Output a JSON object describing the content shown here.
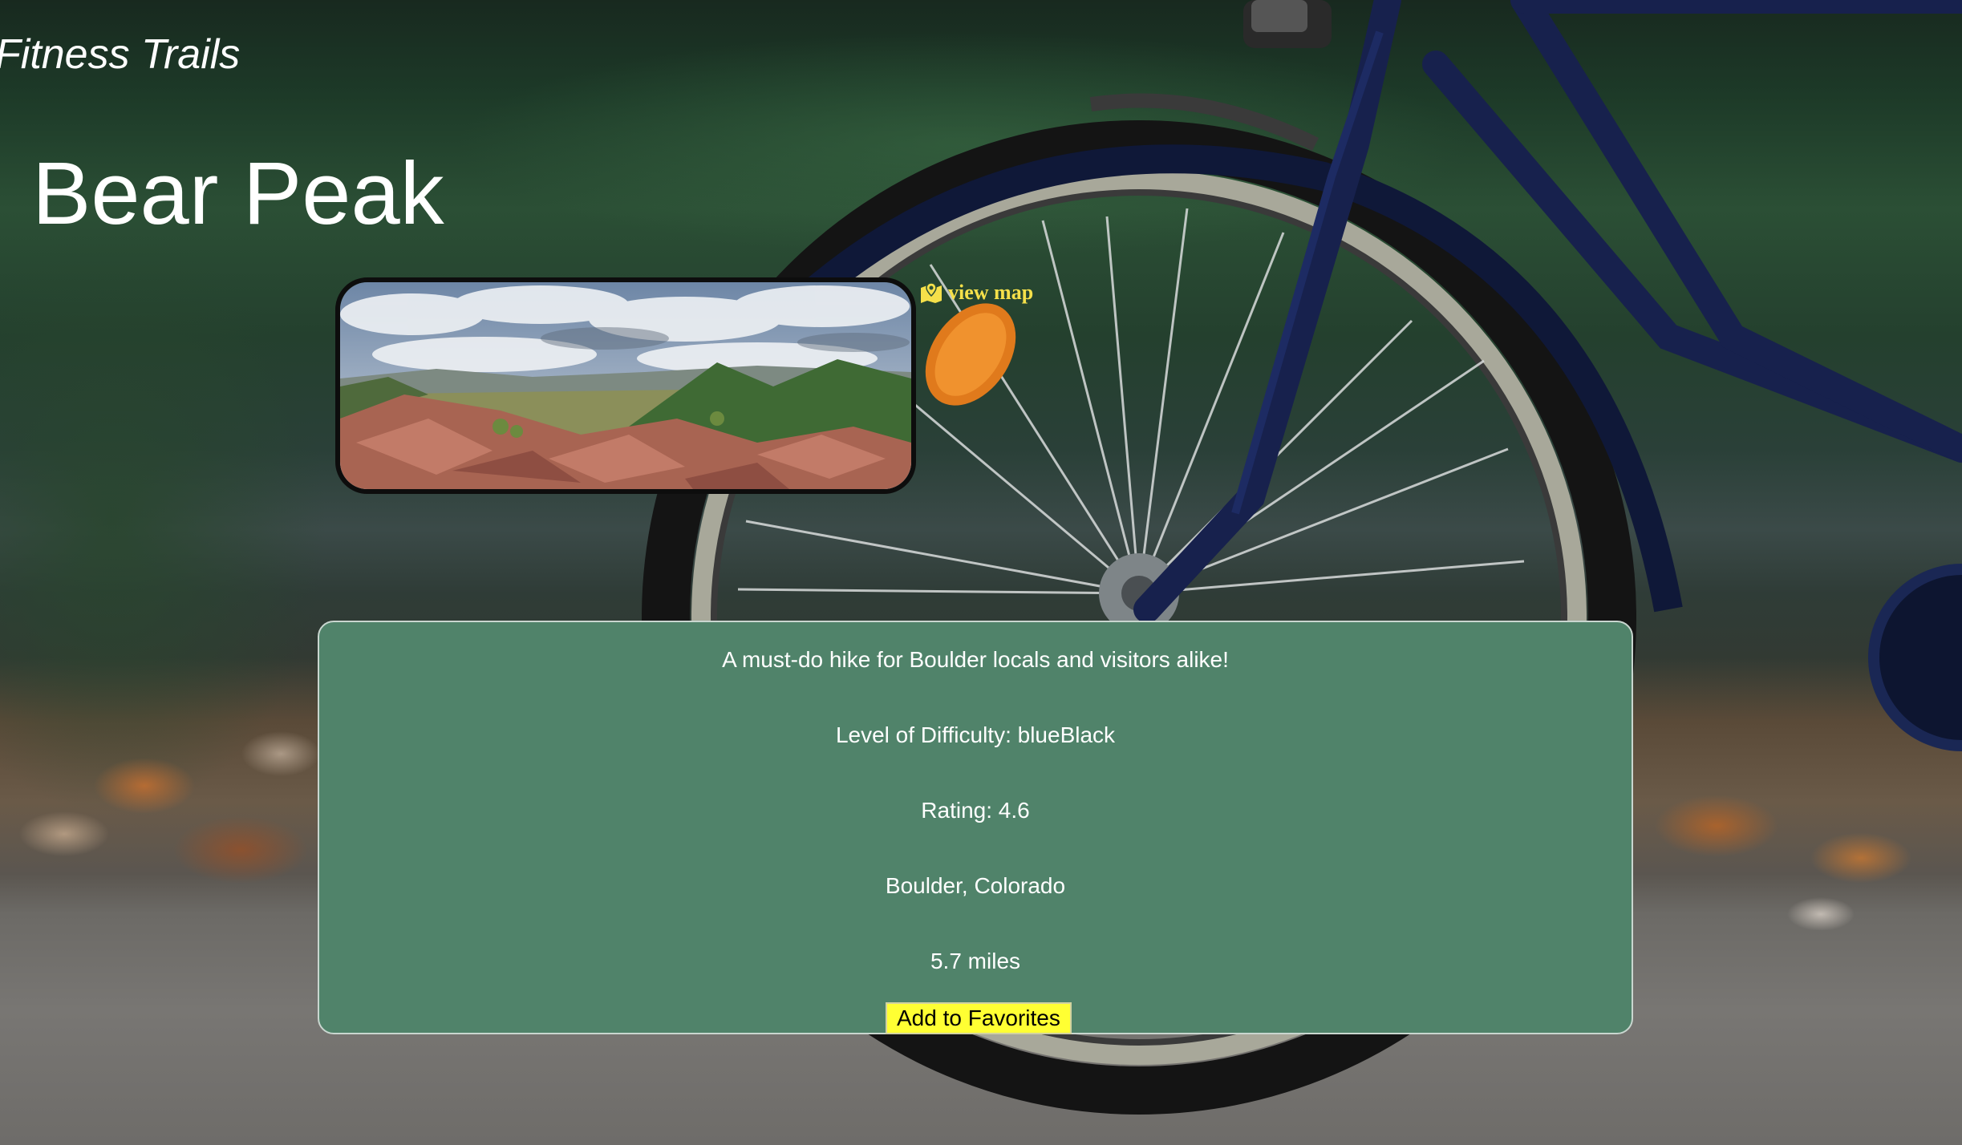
{
  "header": {
    "site_title": "Fitness Trails"
  },
  "trail": {
    "name": "Bear Peak",
    "view_map_label": "view map",
    "description": "A must-do hike for Boulder locals and visitors alike!",
    "difficulty": "Level of Difficulty: blueBlack",
    "rating": "Rating: 4.6",
    "location": "Boulder, Colorado",
    "length": "5.7 miles",
    "favorite_button_label": "Add to Favorites"
  },
  "icons": {
    "view_map": "map-marker-icon"
  },
  "colors": {
    "card_background": "#50836a",
    "button_background": "#ffff33",
    "link_color": "#f5e04a",
    "text": "#ffffff"
  }
}
